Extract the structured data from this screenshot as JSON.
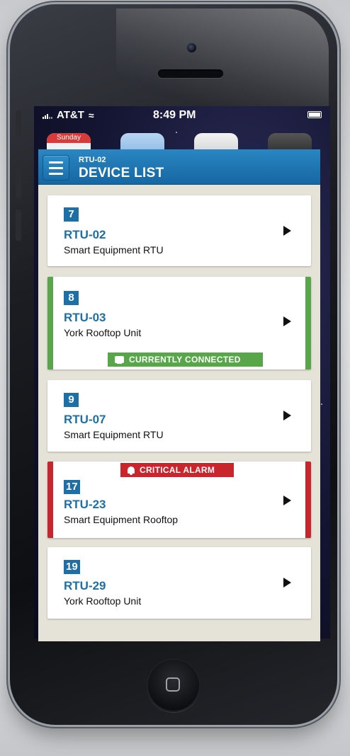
{
  "status_bar": {
    "carrier": "AT&T",
    "time": "8:49 PM"
  },
  "home_screen": {
    "calendar_day": "Sunday"
  },
  "app": {
    "header": {
      "subtitle": "RTU-02",
      "title": "DEVICE LIST"
    },
    "devices": [
      {
        "number": "7",
        "name": "RTU-02",
        "description": "Smart Equipment RTU",
        "status": ""
      },
      {
        "number": "8",
        "name": "RTU-03",
        "description": "York Rooftop Unit",
        "status": "CURRENTLY CONNECTED"
      },
      {
        "number": "9",
        "name": "RTU-07",
        "description": "Smart Equipment RTU",
        "status": ""
      },
      {
        "number": "17",
        "name": "RTU-23",
        "description": "Smart Equipment Rooftop",
        "status": "CRITICAL ALARM"
      },
      {
        "number": "19",
        "name": "RTU-29",
        "description": "York Rooftop Unit",
        "status": ""
      }
    ]
  },
  "colors": {
    "header_blue": "#1d6fa8",
    "connected_green": "#58a64a",
    "alarm_red": "#c8252d",
    "list_background": "#e5e2d8"
  }
}
